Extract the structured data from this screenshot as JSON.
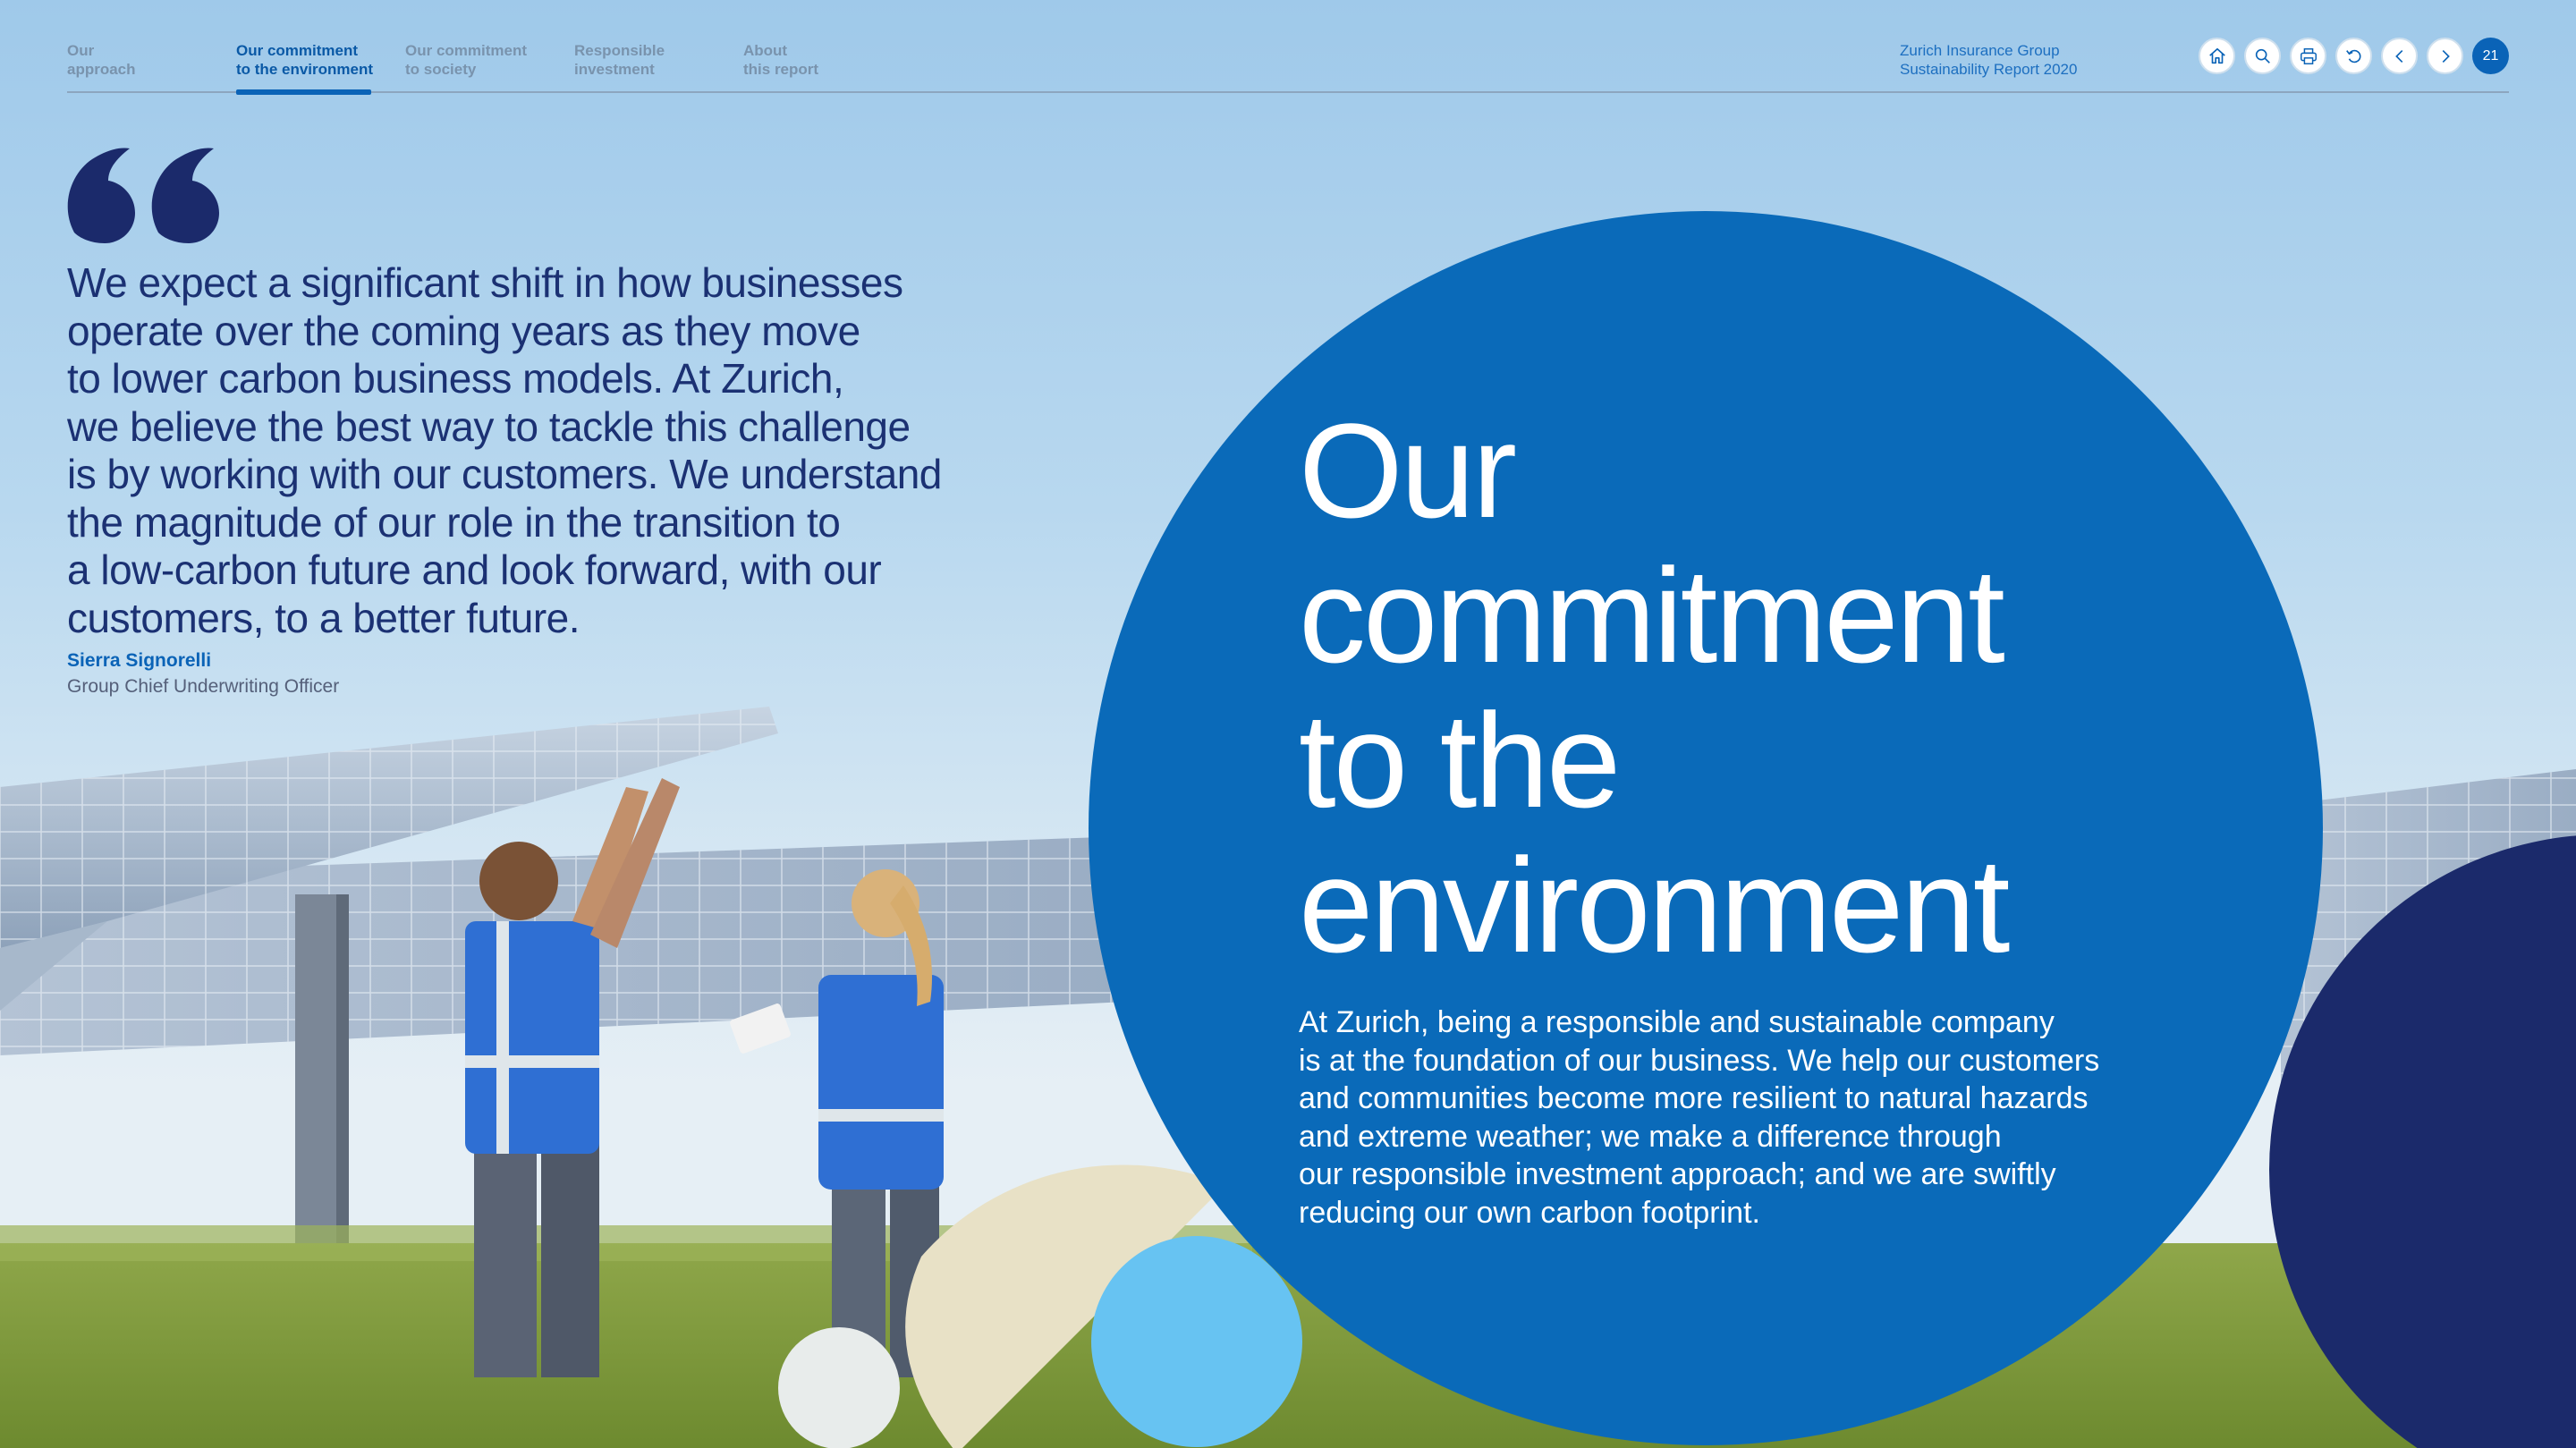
{
  "nav": {
    "tabs": [
      {
        "line1": "Our",
        "line2": "approach",
        "active": false
      },
      {
        "line1": "Our commitment",
        "line2": "to the environment",
        "active": true
      },
      {
        "line1": "Our commitment",
        "line2": "to society",
        "active": false
      },
      {
        "line1": "Responsible",
        "line2": "investment",
        "active": false
      },
      {
        "line1": "About",
        "line2": "this report",
        "active": false
      }
    ],
    "report_title_line1": "Zurich Insurance Group",
    "report_title_line2": "Sustainability Report 2020",
    "icons": [
      "home-icon",
      "search-icon",
      "print-icon",
      "undo-icon",
      "chevron-left-icon",
      "chevron-right-icon"
    ],
    "page_number": "21"
  },
  "quote": {
    "lines": [
      "We expect a significant shift in how businesses",
      "operate over the coming years as they move",
      "to lower carbon business models. At Zurich,",
      "we believe the best way to tackle this challenge",
      "is by working with our customers. We understand",
      "the magnitude of our role in the transition to",
      "a low-carbon future and look forward, with our",
      "customers, to a better future."
    ],
    "author": "Sierra Signorelli",
    "role": "Group Chief Underwriting Officer"
  },
  "section": {
    "headline_lines": [
      "Our",
      "commitment",
      "to the",
      "environment"
    ],
    "body_lines": [
      "At Zurich, being a responsible and sustainable company",
      "is at the foundation of our business. We help our customers",
      "and communities become more resilient to natural hazards",
      "and extreme weather; we make a difference through",
      "our responsible investment approach; and we are swiftly",
      "reducing our own carbon footprint."
    ]
  },
  "colors": {
    "brand_blue": "#0a6ab9",
    "navy": "#1b2a6b",
    "light_blue": "#67c3f2",
    "beige": "#e8e1c6",
    "quote_text": "#1b3173"
  }
}
